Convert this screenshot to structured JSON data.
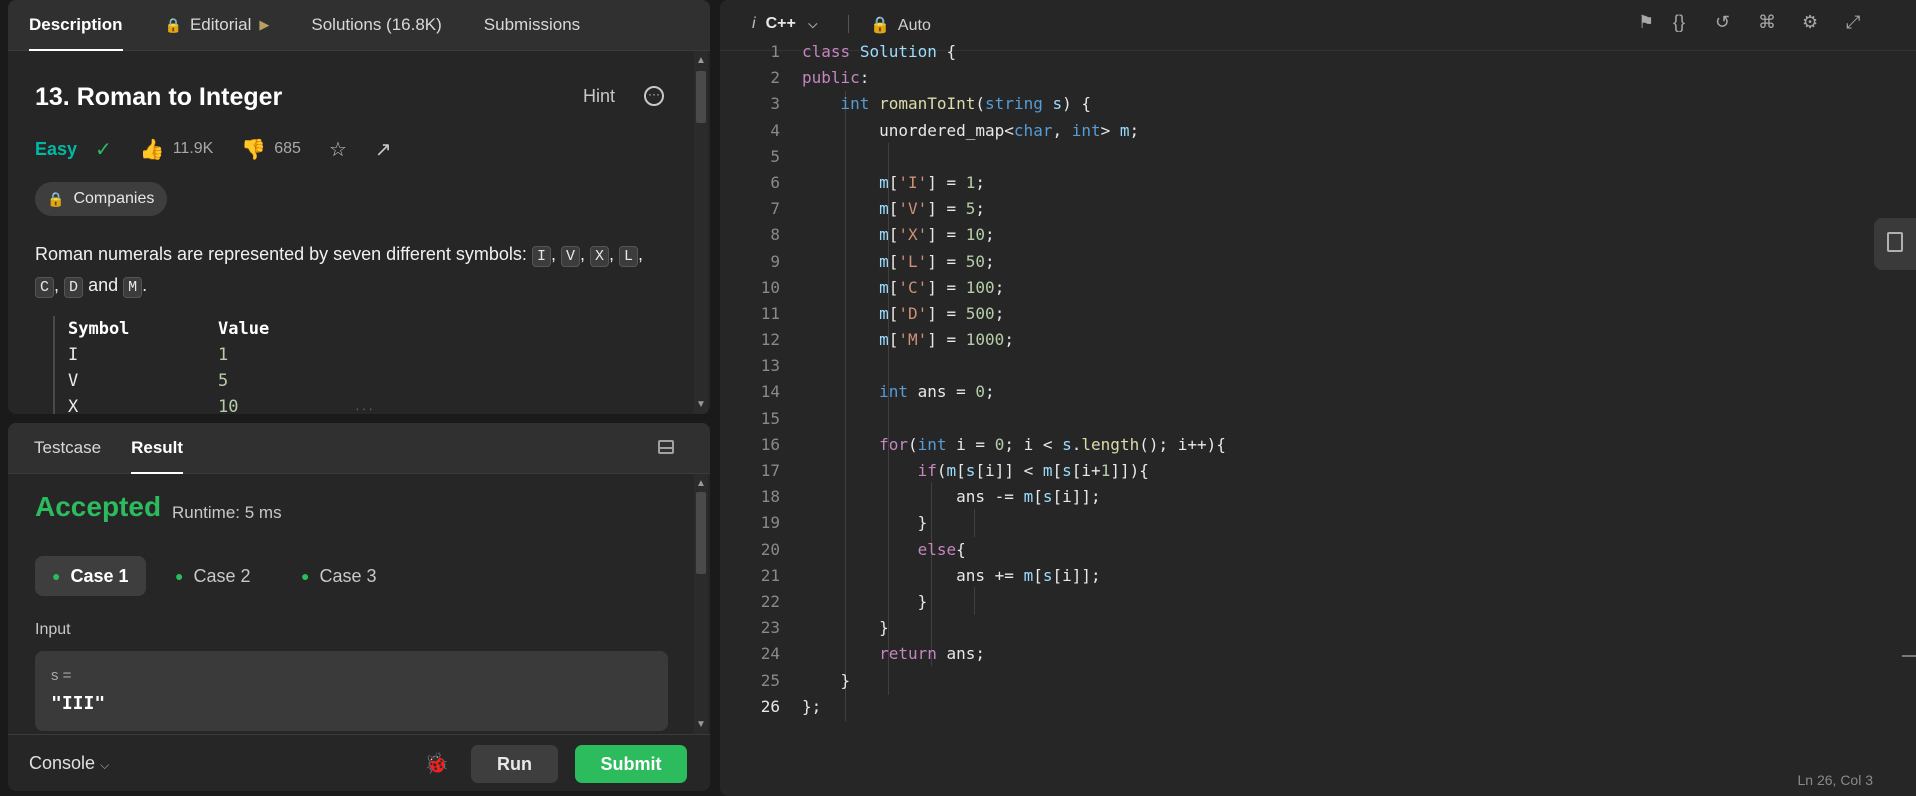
{
  "left_tabs": [
    "Description",
    "Editorial",
    "Solutions (16.8K)",
    "Submissions"
  ],
  "problem": {
    "title": "13. Roman to Integer",
    "hint": "Hint",
    "difficulty": "Easy",
    "likes": "11.9K",
    "dislikes": "685",
    "companies": "Companies",
    "intro": "Roman numerals are represented by seven different symbols:",
    "symbols": [
      "I",
      "V",
      "X",
      "L",
      "C",
      "D",
      "M"
    ],
    "and_word": "and",
    "table_header": [
      "Symbol",
      "Value"
    ],
    "table_rows": [
      [
        "I",
        "1"
      ],
      [
        "V",
        "5"
      ],
      [
        "X",
        "10"
      ]
    ]
  },
  "result": {
    "tabs": [
      "Testcase",
      "Result"
    ],
    "status": "Accepted",
    "runtime": "Runtime: 5 ms",
    "cases": [
      "Case 1",
      "Case 2",
      "Case 3"
    ],
    "input_label": "Input",
    "input_var": "s =",
    "input_value": "\"III\""
  },
  "footer": {
    "console": "Console",
    "run": "Run",
    "submit": "Submit"
  },
  "editor": {
    "language": "C++",
    "mode": "Auto",
    "status": "Ln 26, Col 3",
    "current_line": 26,
    "line_numbers": [
      "1",
      "2",
      "3",
      "4",
      "5",
      "6",
      "7",
      "8",
      "9",
      "10",
      "11",
      "12",
      "13",
      "14",
      "15",
      "16",
      "17",
      "18",
      "19",
      "20",
      "21",
      "22",
      "23",
      "24",
      "25",
      "26"
    ],
    "code_lines": [
      "class Solution {",
      "public:",
      "    int romanToInt(string s) {",
      "        unordered_map<char, int> m;",
      "",
      "        m['I'] = 1;",
      "        m['V'] = 5;",
      "        m['X'] = 10;",
      "        m['L'] = 50;",
      "        m['C'] = 100;",
      "        m['D'] = 500;",
      "        m['M'] = 1000;",
      "",
      "        int ans = 0;",
      "",
      "        for(int i = 0; i < s.length(); i++){",
      "            if(m[s[i]] < m[s[i+1]]){",
      "                ans -= m[s[i]];",
      "            }",
      "            else{",
      "                ans += m[s[i]];",
      "            }",
      "        }",
      "        return ans;",
      "    }",
      "};"
    ]
  },
  "colors": {
    "accent_green": "#2cbb5d",
    "easy": "#00b8a3",
    "lock": "#ffa116"
  }
}
